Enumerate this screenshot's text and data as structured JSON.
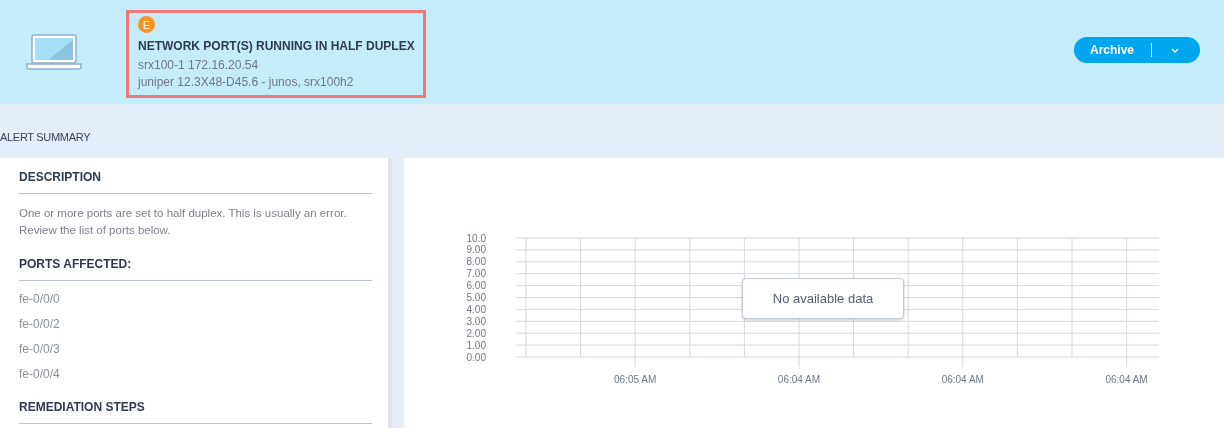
{
  "alert": {
    "severity_badge": "E",
    "title": "NETWORK PORT(S) RUNNING IN HALF DUPLEX",
    "device": "srx100-1 172.16.20.54",
    "platform": "juniper 12.3X48-D45.6 - junos, srx100h2",
    "highlighted": true
  },
  "archive_button": {
    "label": "Archive"
  },
  "section_title": "ALERT SUMMARY",
  "summary": {
    "sections": [
      {
        "heading": "DESCRIPTION",
        "text": "One or more ports are set to half duplex. This is usually an error. Review the list of ports below."
      },
      {
        "heading": "PORTS AFFECTED:",
        "items": [
          "fe-0/0/0",
          "fe-0/0/2",
          "fe-0/0/3",
          "fe-0/0/4"
        ]
      },
      {
        "heading": "REMEDIATION STEPS"
      }
    ]
  },
  "chart": {
    "empty_message": "No available data",
    "chart_data": {
      "type": "line",
      "grid": true,
      "ylim": [
        0,
        10
      ],
      "yticks": [
        {
          "value": 10,
          "label": "10.0"
        },
        {
          "value": 9,
          "label": "9.00"
        },
        {
          "value": 8,
          "label": "8.00"
        },
        {
          "value": 7,
          "label": "7.00"
        },
        {
          "value": 6,
          "label": "6.00"
        },
        {
          "value": 5,
          "label": "5.00"
        },
        {
          "value": 4,
          "label": "4.00"
        },
        {
          "value": 3,
          "label": "3.00"
        },
        {
          "value": 2,
          "label": "2.00"
        },
        {
          "value": 1,
          "label": "1.00"
        },
        {
          "value": 0,
          "label": "0.00"
        }
      ],
      "categories": [
        "06:05 AM",
        "06:04 AM",
        "06:04 AM",
        "06:04 AM"
      ]
    }
  }
}
